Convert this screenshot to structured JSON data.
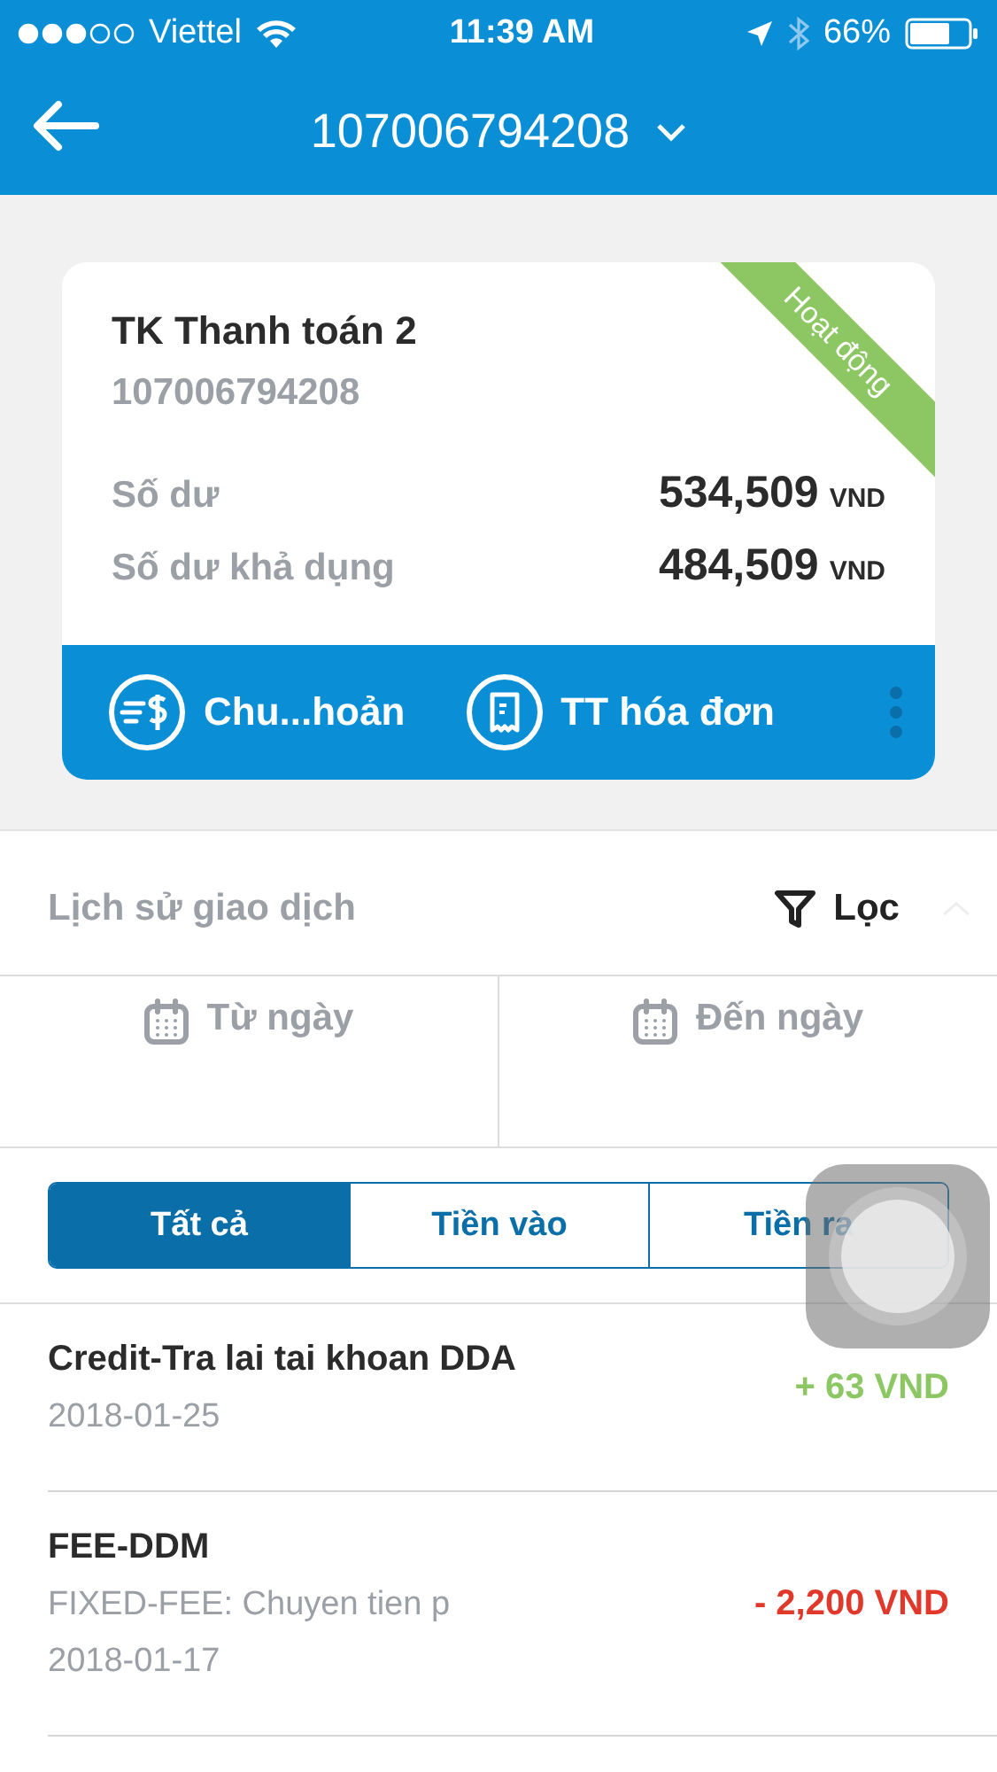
{
  "status_bar": {
    "carrier": "Viettel",
    "time": "11:39 AM",
    "battery": "66%"
  },
  "nav": {
    "title": "107006794208"
  },
  "account": {
    "name": "TK Thanh toán 2",
    "number": "107006794208",
    "status": "Hoạt động",
    "balances": [
      {
        "label": "Số dư",
        "amount": "534,509",
        "currency": "VND"
      },
      {
        "label": "Số dư khả dụng",
        "amount": "484,509",
        "currency": "VND"
      }
    ],
    "actions": [
      {
        "kind": "transfer",
        "label": "Chu...hoản"
      },
      {
        "kind": "bill",
        "label": "TT hóa đơn"
      }
    ]
  },
  "history": {
    "title": "Lịch sử giao dịch",
    "filter": "Lọc"
  },
  "date_filters": [
    {
      "label": "Từ ngày"
    },
    {
      "label": "Đến ngày"
    }
  ],
  "tabs": [
    {
      "label": "Tất cả",
      "selected": true
    },
    {
      "label": "Tiền vào",
      "selected": false
    },
    {
      "label": "Tiền ra",
      "selected": false
    }
  ],
  "transactions": [
    {
      "kind": "in",
      "title": "Credit-Tra lai tai khoan DDA",
      "date": "2018-01-25",
      "amount": "+ 63 VND"
    },
    {
      "kind": "out",
      "title": "FEE-DDM",
      "description": "FIXED-FEE: Chuyen tien p",
      "date": "2018-01-17",
      "amount": "- 2,200 VND"
    }
  ]
}
